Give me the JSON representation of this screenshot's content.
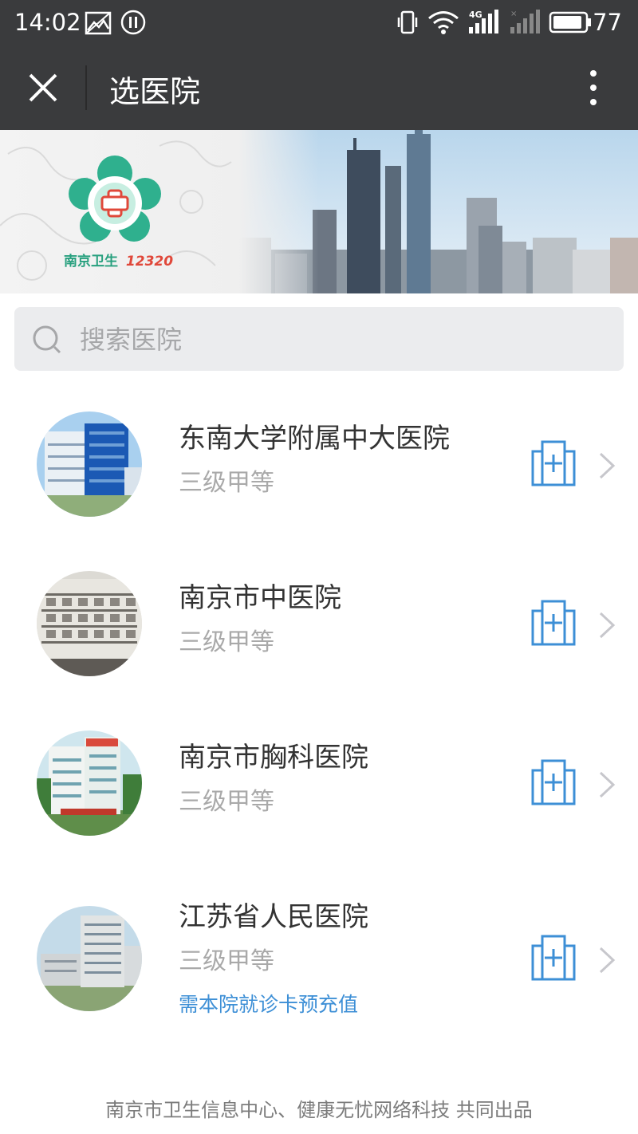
{
  "status_bar": {
    "time": "14:02",
    "network": "4G",
    "battery": "77"
  },
  "header": {
    "title": "选医院"
  },
  "banner": {
    "logo_text": "南京卫生",
    "logo_number": "12320"
  },
  "search": {
    "placeholder": "搜索医院"
  },
  "hospitals": [
    {
      "name": "东南大学附属中大医院",
      "level": "三级甲等"
    },
    {
      "name": "南京市中医院",
      "level": "三级甲等"
    },
    {
      "name": "南京市胸科医院",
      "level": "三级甲等"
    },
    {
      "name": "江苏省人民医院",
      "level": "三级甲等",
      "note": "需本院就诊卡预充值"
    }
  ],
  "footer": {
    "text": "南京市卫生信息中心、健康无忧网络科技 共同出品"
  },
  "colors": {
    "header_bg": "#3a3b3d",
    "accent_blue": "#3d8fd6",
    "search_bg": "#ebecee"
  }
}
